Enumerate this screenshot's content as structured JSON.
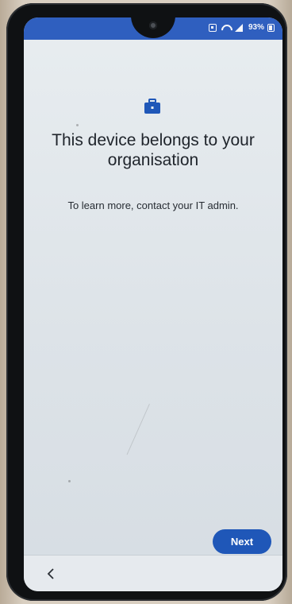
{
  "status_bar": {
    "battery_text": "93%",
    "accent_color": "#2f5fbf"
  },
  "main": {
    "icon": "briefcase-icon",
    "title": "This device belongs to your organisation",
    "subtitle": "To learn more, contact your IT admin."
  },
  "actions": {
    "next_label": "Next",
    "next_color": "#1f57b8"
  },
  "navigation": {
    "back_icon": "back-chevron-icon"
  }
}
